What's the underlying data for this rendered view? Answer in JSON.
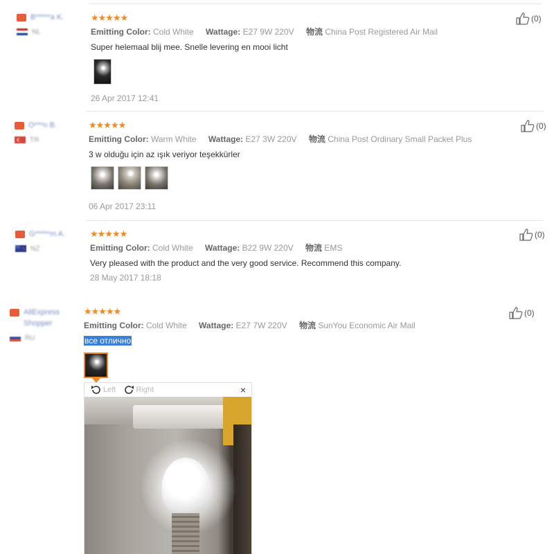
{
  "labels": {
    "emitting_color": "Emitting Color:",
    "wattage": "Wattage:",
    "shipping": "物流"
  },
  "reviews": [
    {
      "user": "B*****a K.",
      "country": "NL",
      "stars": "★★★★★",
      "emitting_color": "Cold White",
      "wattage": "E27 9W 220V",
      "shipping": "China Post Registered Air Mail",
      "text": "Super helemaal blij mee. Snelle levering en mooi licht",
      "date": "26 Apr 2017 12:41",
      "helpful": "(0)"
    },
    {
      "user": "O***n B.",
      "country": "TR",
      "stars": "★★★★★",
      "emitting_color": "Warm White",
      "wattage": "E27 3W 220V",
      "shipping": "China Post Ordinary Small Packet Plus",
      "text": "3 w olduğu için az ışık veriyor teşekkürler",
      "date": "06 Apr 2017 23:11",
      "helpful": "(0)"
    },
    {
      "user": "G*****m A.",
      "country": "NZ",
      "stars": "★★★★★",
      "emitting_color": "Cold White",
      "wattage": "B22 9W 220V",
      "shipping": "EMS",
      "text": "Very pleased with the product and the very good service. Recommend this company.",
      "date": "28 May 2017 18:18",
      "helpful": "(0)"
    },
    {
      "user": "AliExpress Shopper",
      "country": "RU",
      "stars": "★★★★★",
      "emitting_color": "Cold White",
      "wattage": "E27 7W 220V",
      "shipping": "SunYou Economic Air Mail",
      "text": "все отлично",
      "helpful": "(0)"
    }
  ],
  "viewer": {
    "rotate_left": "Left",
    "rotate_right": "Right",
    "close": "×"
  },
  "colors": {
    "star": "#f5871f",
    "highlight": "#3a7fd9",
    "username": "#7a8fc2"
  }
}
